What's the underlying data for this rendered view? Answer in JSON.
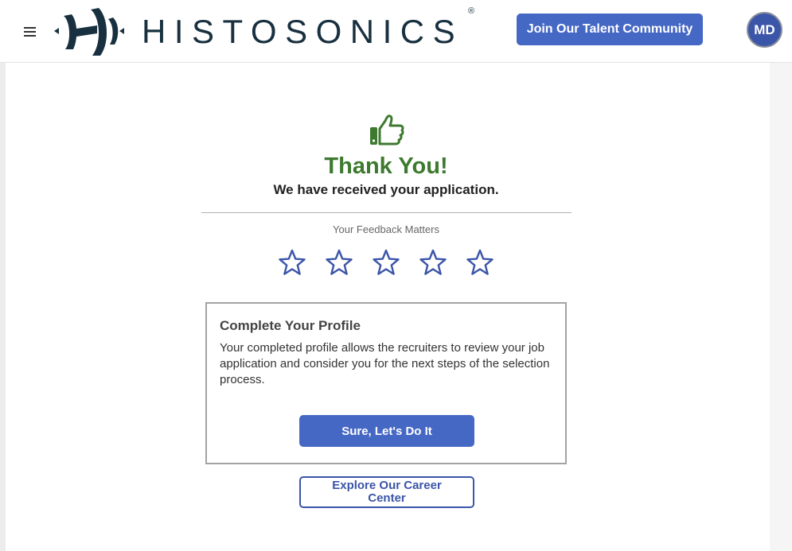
{
  "header": {
    "menu_icon": "hamburger-menu-icon",
    "logo_text": "HISTOSONICS",
    "logo_reg": "®",
    "join_label": "Join Our Talent Community",
    "avatar_initials": "MD"
  },
  "confirmation": {
    "icon": "thumbs-up-icon",
    "title": "Thank You!",
    "message": "We have received your application.",
    "feedback_label": "Your Feedback Matters",
    "rating_icon": "star-outline-icon",
    "rating_max": 5
  },
  "profile": {
    "title": "Complete Your Profile",
    "description": "Your completed profile allows the recruiters to review your job application and consider you for the next steps of the selection process.",
    "cta_label": "Sure, Let's Do It"
  },
  "career": {
    "label": "Explore Our Career Center"
  },
  "colors": {
    "accent": "#4668c5",
    "success": "#3d7a2f",
    "brand_dark": "#18303f"
  }
}
